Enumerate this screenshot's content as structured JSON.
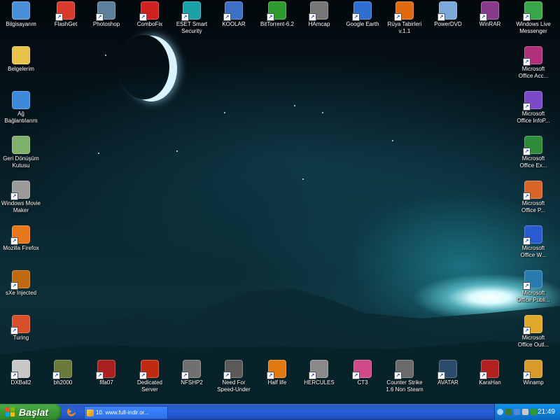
{
  "desktop": {
    "top_row": [
      {
        "label": "Bilgisayarım",
        "icon": "computer-icon",
        "color": "#4a90d9"
      },
      {
        "label": "FlashGet",
        "icon": "flashget-icon",
        "color": "#d93a2b"
      },
      {
        "label": "Photoshop",
        "icon": "photoshop-icon",
        "color": "#5e7f9a"
      },
      {
        "label": "ComboFix",
        "icon": "combofix-icon",
        "color": "#d02020"
      },
      {
        "label": "ESET Smart\nSecurity",
        "icon": "eset-icon",
        "color": "#1aa0a8"
      },
      {
        "label": "KOOLAR",
        "icon": "document-icon",
        "color": "#3d6fc4"
      },
      {
        "label": "BitTorrent-6.2",
        "icon": "bittorrent-icon",
        "color": "#2f9b2f"
      },
      {
        "label": "HAmcap",
        "icon": "hamcap-icon",
        "color": "#777777"
      },
      {
        "label": "Google Earth",
        "icon": "google-earth-icon",
        "color": "#2f6fd1"
      },
      {
        "label": "Rüya Tabirleri\nv.1.1",
        "icon": "ruya-icon",
        "color": "#e06a10"
      },
      {
        "label": "PowerDVD",
        "icon": "powerdvd-icon",
        "color": "#7aa8d8"
      },
      {
        "label": "WinRAR",
        "icon": "winrar-icon",
        "color": "#8a3a8a"
      },
      {
        "label": "Windows Live\nMessenger",
        "icon": "messenger-icon",
        "color": "#3aa64a"
      }
    ],
    "left_column": [
      {
        "label": "Belgelerim",
        "icon": "my-documents-icon",
        "color": "#e8c24a"
      },
      {
        "label": "Ağ\nBağlantılarım",
        "icon": "network-icon",
        "color": "#3c8ad8"
      },
      {
        "label": "Geri Dönüşüm\nKutusu",
        "icon": "recycle-bin-icon",
        "color": "#7fb06b"
      },
      {
        "label": "Windows Movie\nMaker",
        "icon": "movie-maker-icon",
        "color": "#9a9a9a"
      },
      {
        "label": "Mozilla Firefox",
        "icon": "firefox-icon",
        "color": "#e8761b"
      },
      {
        "label": "sXe Injected",
        "icon": "sxe-icon",
        "color": "#c06a10"
      },
      {
        "label": "Turing",
        "icon": "turing-icon",
        "color": "#d8502a"
      }
    ],
    "right_column": [
      {
        "label": "Microsoft\nOffice Acc...",
        "icon": "access-icon",
        "color": "#b0307a"
      },
      {
        "label": "Microsoft\nOffice InfoP...",
        "icon": "infopath-icon",
        "color": "#7a4ac8"
      },
      {
        "label": "Microsoft\nOffice Ex...",
        "icon": "excel-icon",
        "color": "#2e8b3a"
      },
      {
        "label": "Microsoft\nOffice P...",
        "icon": "powerpoint-icon",
        "color": "#d8662a"
      },
      {
        "label": "Microsoft\nOffice W...",
        "icon": "word-icon",
        "color": "#2a5ad0"
      },
      {
        "label": "Microsoft\nOffice Publi...",
        "icon": "publisher-icon",
        "color": "#2a7ab0"
      },
      {
        "label": "Microsoft\nOffice Outl...",
        "icon": "outlook-icon",
        "color": "#e0a82a"
      }
    ],
    "bottom_row": [
      {
        "label": "DXBall2",
        "icon": "dxball-icon",
        "color": "#c8c8c8"
      },
      {
        "label": "bh2000",
        "icon": "bh2000-icon",
        "color": "#6a7a3a"
      },
      {
        "label": "fifa07",
        "icon": "fifa-icon",
        "color": "#a82020"
      },
      {
        "label": "Dedicated\nServer",
        "icon": "halflife-server-icon",
        "color": "#c02a10"
      },
      {
        "label": "NFSHP2",
        "icon": "nfs-icon",
        "color": "#707070"
      },
      {
        "label": "Need For\nSpeed-Under",
        "icon": "nfsu-icon",
        "color": "#5a5a5a"
      },
      {
        "label": "Half life",
        "icon": "halflife-icon",
        "color": "#e07a10"
      },
      {
        "label": "HERCULES",
        "icon": "hercules-icon",
        "color": "#8a8a8a"
      },
      {
        "label": "CT3",
        "icon": "ct3-icon",
        "color": "#d04a8a"
      },
      {
        "label": "Counter Strike\n1.6 Non Steam",
        "icon": "counter-strike-icon",
        "color": "#6a6a6a"
      },
      {
        "label": "AVATAR",
        "icon": "avatar-icon",
        "color": "#2a4a6a"
      },
      {
        "label": "KaraHan",
        "icon": "karahan-icon",
        "color": "#b02020"
      },
      {
        "label": "Winamp",
        "icon": "winamp-icon",
        "color": "#d89a2a"
      }
    ]
  },
  "taskbar": {
    "start_label": "Başlat",
    "task_label": "10. www.full-indir.or...",
    "clock": "21:49"
  },
  "colors": {
    "taskbar": "#245edb",
    "start": "#3a9a35",
    "tray": "#0f7fd8"
  }
}
